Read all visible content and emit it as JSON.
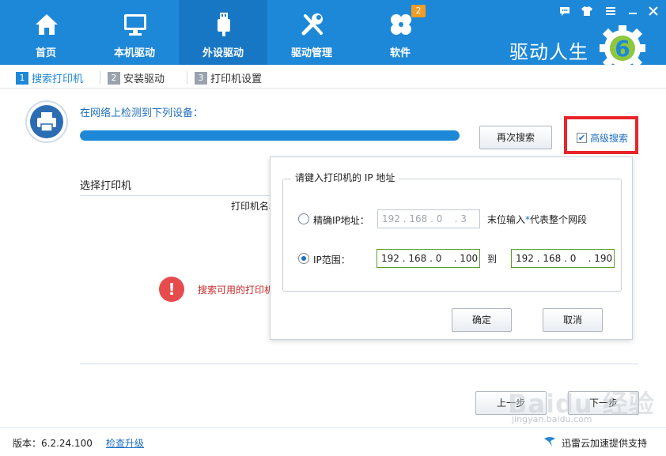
{
  "nav": {
    "items": [
      {
        "label": "首页",
        "icon": "home-icon"
      },
      {
        "label": "本机驱动",
        "icon": "monitor-icon"
      },
      {
        "label": "外设驱动",
        "icon": "usb-icon"
      },
      {
        "label": "驱动管理",
        "icon": "tools-icon"
      },
      {
        "label": "软件",
        "icon": "apps-icon"
      }
    ],
    "active_index": 2,
    "software_badge": "2"
  },
  "brand": {
    "name": "驱动人生",
    "logo_digit": "6"
  },
  "window_controls": [
    "chat-icon",
    "shirt-icon",
    "menu-icon",
    "minimize-icon",
    "close-icon"
  ],
  "steps": [
    {
      "num": "1",
      "label": "搜索打印机",
      "active": true
    },
    {
      "num": "2",
      "label": "安装驱动",
      "active": false
    },
    {
      "num": "3",
      "label": "打印机设置",
      "active": false
    }
  ],
  "detect": {
    "message": "在网络上检测到下列设备：",
    "progress": 1.0,
    "research_button": "再次搜索",
    "advanced_label": "高级搜索",
    "advanced_checked": true
  },
  "printer_list": {
    "title": "选择打印机",
    "column_name": "打印机名称",
    "error_text": "搜索可用的打印机"
  },
  "ip_dialog": {
    "legend": "请键入打印机的 IP 地址",
    "exact_label": "精确IP地址：",
    "exact_value": "192 . 168 . 0    . 3",
    "exact_selected": false,
    "exact_note_prefix": "末位输入",
    "exact_note_star": "*",
    "exact_note_suffix": "代表整个网段",
    "range_label": "IP范围：",
    "range_selected": true,
    "range_from": "192 . 168 . 0    . 100",
    "range_to_label": "到",
    "range_to": "192 . 168 . 0    . 190",
    "ok_button": "确定",
    "cancel_button": "取消"
  },
  "wizard": {
    "prev_button": "上一步",
    "next_button": "下一步"
  },
  "footer": {
    "version": "版本：6.2.24.100",
    "upgrade_link": "检查升级",
    "thunder_text": "迅雷云加速提供支持"
  },
  "watermark": {
    "main": "Baidu 经验",
    "sub": "jingyan.baidu.com"
  },
  "colors": {
    "primary": "#1e88d8",
    "active_tab": "#1877c4",
    "highlight_box": "#e8242c",
    "badge": "#f39c26",
    "error": "#e74c4c"
  }
}
